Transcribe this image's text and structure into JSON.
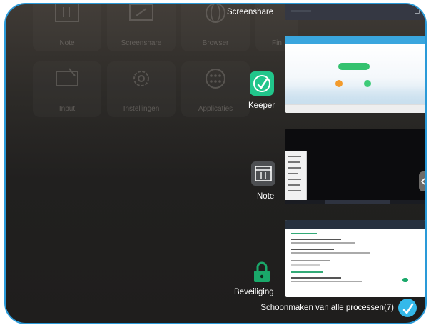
{
  "launcher": {
    "tiles": [
      {
        "label": "Note"
      },
      {
        "label": "Screenshare"
      },
      {
        "label": "Browser"
      },
      {
        "label": "Fin"
      },
      {
        "label": "Input"
      },
      {
        "label": "Instellingen"
      },
      {
        "label": "Applicaties"
      }
    ]
  },
  "recents": {
    "apps": [
      {
        "title": "Screenshare",
        "icon": "screenshare-icon"
      },
      {
        "title": "Keeper",
        "icon": "keeper-icon"
      },
      {
        "title": "Note",
        "icon": "note-icon"
      },
      {
        "title": "Beveiliging",
        "icon": "lock-icon"
      }
    ],
    "clean_all_label": "Schoonmaken van alle processen(7)"
  },
  "colors": {
    "frame_border": "#2a9ad8",
    "keeper_green": "#21c58b",
    "security_green": "#1aa86a",
    "clean_button": "#34b9ea"
  }
}
